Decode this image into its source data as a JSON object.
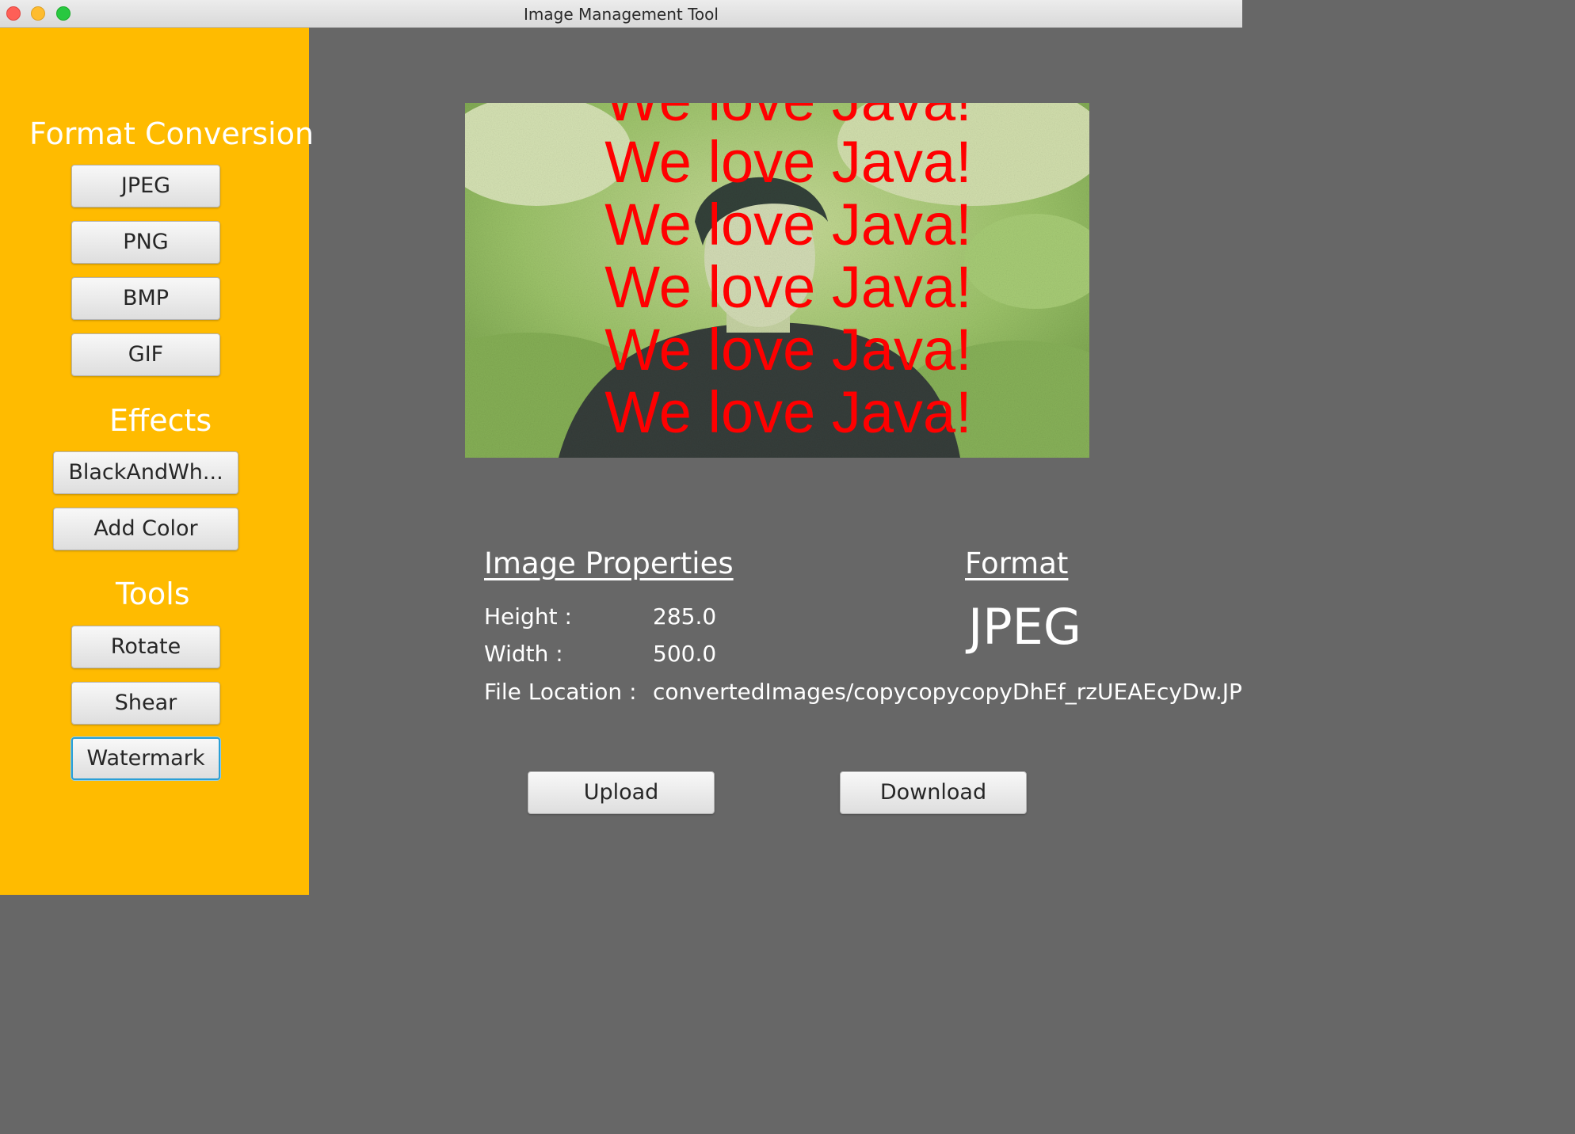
{
  "window": {
    "title": "Image Management Tool"
  },
  "sidebar": {
    "format_heading": "Format Conversion",
    "format_buttons": [
      "JPEG",
      "PNG",
      "BMP",
      "GIF"
    ],
    "effects_heading": "Effects",
    "effects_buttons": [
      "BlackAndWh...",
      "Add Color"
    ],
    "tools_heading": "Tools",
    "tools_buttons": [
      "Rotate",
      "Shear",
      "Watermark"
    ],
    "focused_button": "Watermark"
  },
  "preview": {
    "watermark_text": "We love Java!",
    "watermark_color": "#ff0000"
  },
  "properties": {
    "heading": "Image Properties",
    "height_label": "Height  :",
    "height_value": "285.0",
    "width_label": "Width :",
    "width_value": "500.0",
    "location_label": "File Location :",
    "location_value": "convertedImages/copycopycopyDhEf_rzUEAEcyDw.JPEG"
  },
  "format": {
    "heading": "Format",
    "value": "JPEG"
  },
  "actions": {
    "upload_label": "Upload",
    "download_label": "Download"
  },
  "colors": {
    "sidebar_bg": "#ffbb00",
    "main_bg": "#676767",
    "focus_ring": "#2a9fd6"
  }
}
